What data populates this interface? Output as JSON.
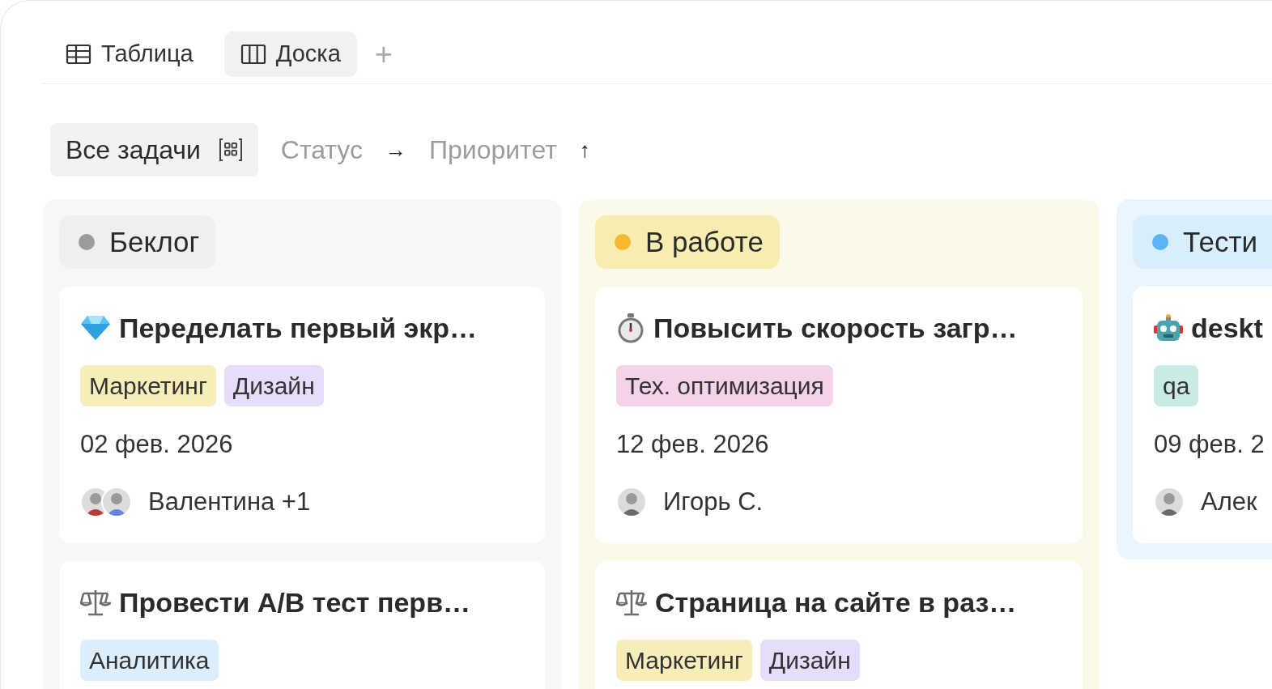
{
  "views": [
    {
      "label": "Таблица",
      "selected": false
    },
    {
      "label": "Доска",
      "selected": true
    }
  ],
  "add_view": "+",
  "filters": [
    {
      "label": "Все задачи",
      "kind": "chip"
    },
    {
      "label": "Статус",
      "kind": "sort",
      "arrow": "→"
    },
    {
      "label": "Приоритет",
      "kind": "sort",
      "arrow": "↑"
    }
  ],
  "columns": [
    {
      "title": "Беклог",
      "color": "#9b9b9b",
      "cards": [
        {
          "title": "Переделать первый экр…",
          "tags": [
            {
              "label": "Маркетинг",
              "color": "#f6edb9"
            },
            {
              "label": "Дизайн",
              "color": "#e8dcfb"
            }
          ],
          "date": "02 фев. 2026",
          "avatars": [
            {
              "color": "#b83a3a"
            },
            {
              "color": "#6b7fe0"
            }
          ],
          "assignee": "Валентина +1"
        },
        {
          "title": "Провести A/B тест перв…",
          "tags": [
            {
              "label": "Аналитика",
              "color": "#dcedfb"
            }
          ]
        }
      ]
    },
    {
      "title": "В работе",
      "color": "#f5b82e",
      "cards": [
        {
          "title": "Повысить скорость загр…",
          "tags": [
            {
              "label": "Тех. оптимизация",
              "color": "#f3d2ea"
            }
          ],
          "date": "12 фев. 2026",
          "avatars": [
            {
              "color": "#6b6b6b"
            }
          ],
          "assignee": "Игорь С."
        },
        {
          "title": "Страница на сайте в раз…",
          "tags": [
            {
              "label": "Маркетинг",
              "color": "#f6edb9"
            },
            {
              "label": "Дизайн",
              "color": "#e8dcfb"
            }
          ]
        }
      ]
    },
    {
      "title": "Тести",
      "color": "#5ab4f5",
      "cards": [
        {
          "title": "deskt",
          "tags": [
            {
              "label": "qa",
              "color": "#c9ebe6"
            }
          ],
          "date": "09 фев. 2",
          "avatars": [
            {
              "color": "#6b6b6b"
            }
          ],
          "assignee": "Алек"
        }
      ]
    }
  ]
}
